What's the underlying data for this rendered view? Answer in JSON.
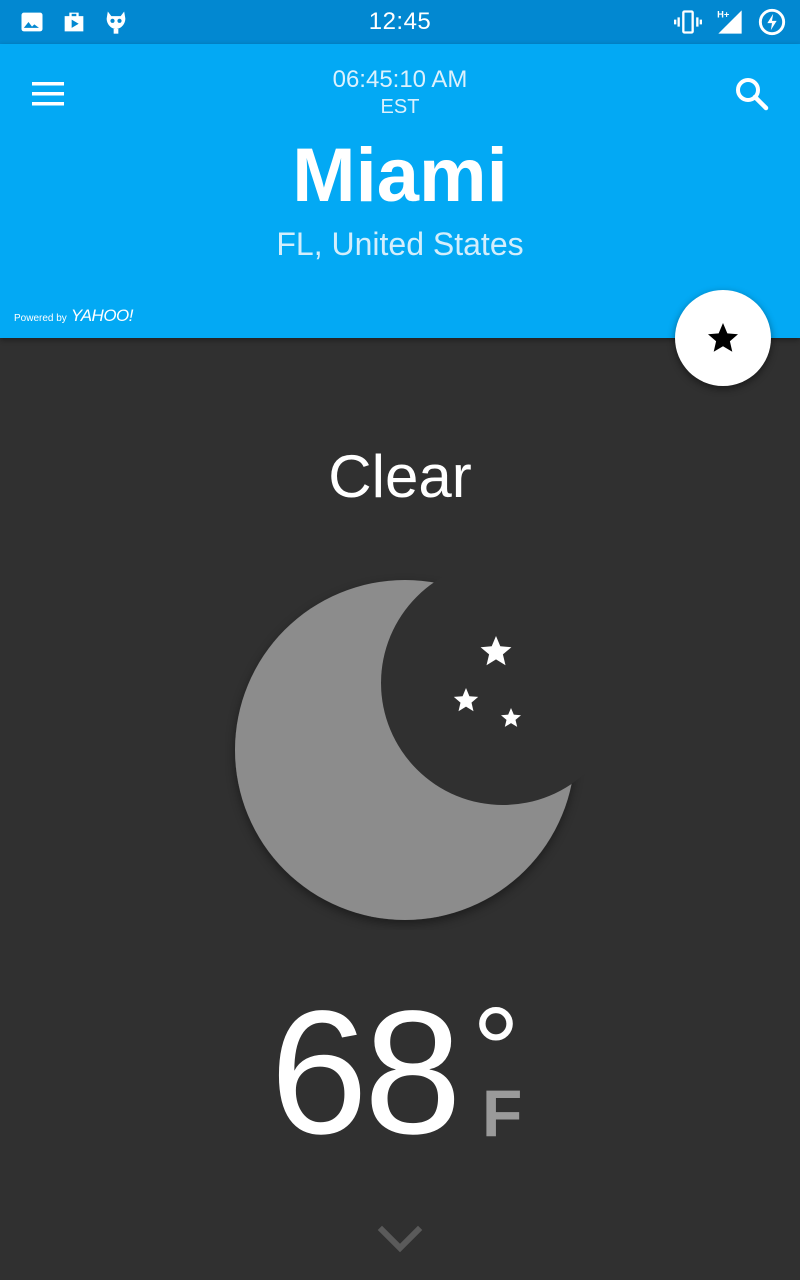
{
  "status_bar": {
    "time": "12:45",
    "left_icons": [
      "gallery-icon",
      "play-store-icon",
      "cyanogen-icon"
    ],
    "right_icons": [
      "vibrate-icon",
      "signal-hplus-icon",
      "battery-charging-icon"
    ],
    "network_label": "H+"
  },
  "header": {
    "local_time": "06:45:10 AM",
    "timezone": "EST",
    "city": "Miami",
    "region": "FL, United States",
    "powered_by": "Powered by",
    "brand": "YAHOO!",
    "menu_icon": "menu-icon",
    "search_icon": "search-icon",
    "background_color": "#03a9f4"
  },
  "favorite_button": {
    "icon": "star-icon"
  },
  "weather": {
    "condition": "Clear",
    "icon": "moon-stars-icon",
    "temperature": "68",
    "degree_symbol": "°",
    "unit": "F"
  },
  "footer": {
    "expand_icon": "chevron-down-icon"
  },
  "colors": {
    "status_bar": "#0288d1",
    "header": "#03a9f4",
    "body": "#303030",
    "moon": "#8c8c8c",
    "unit_text": "#9a9a9a"
  }
}
